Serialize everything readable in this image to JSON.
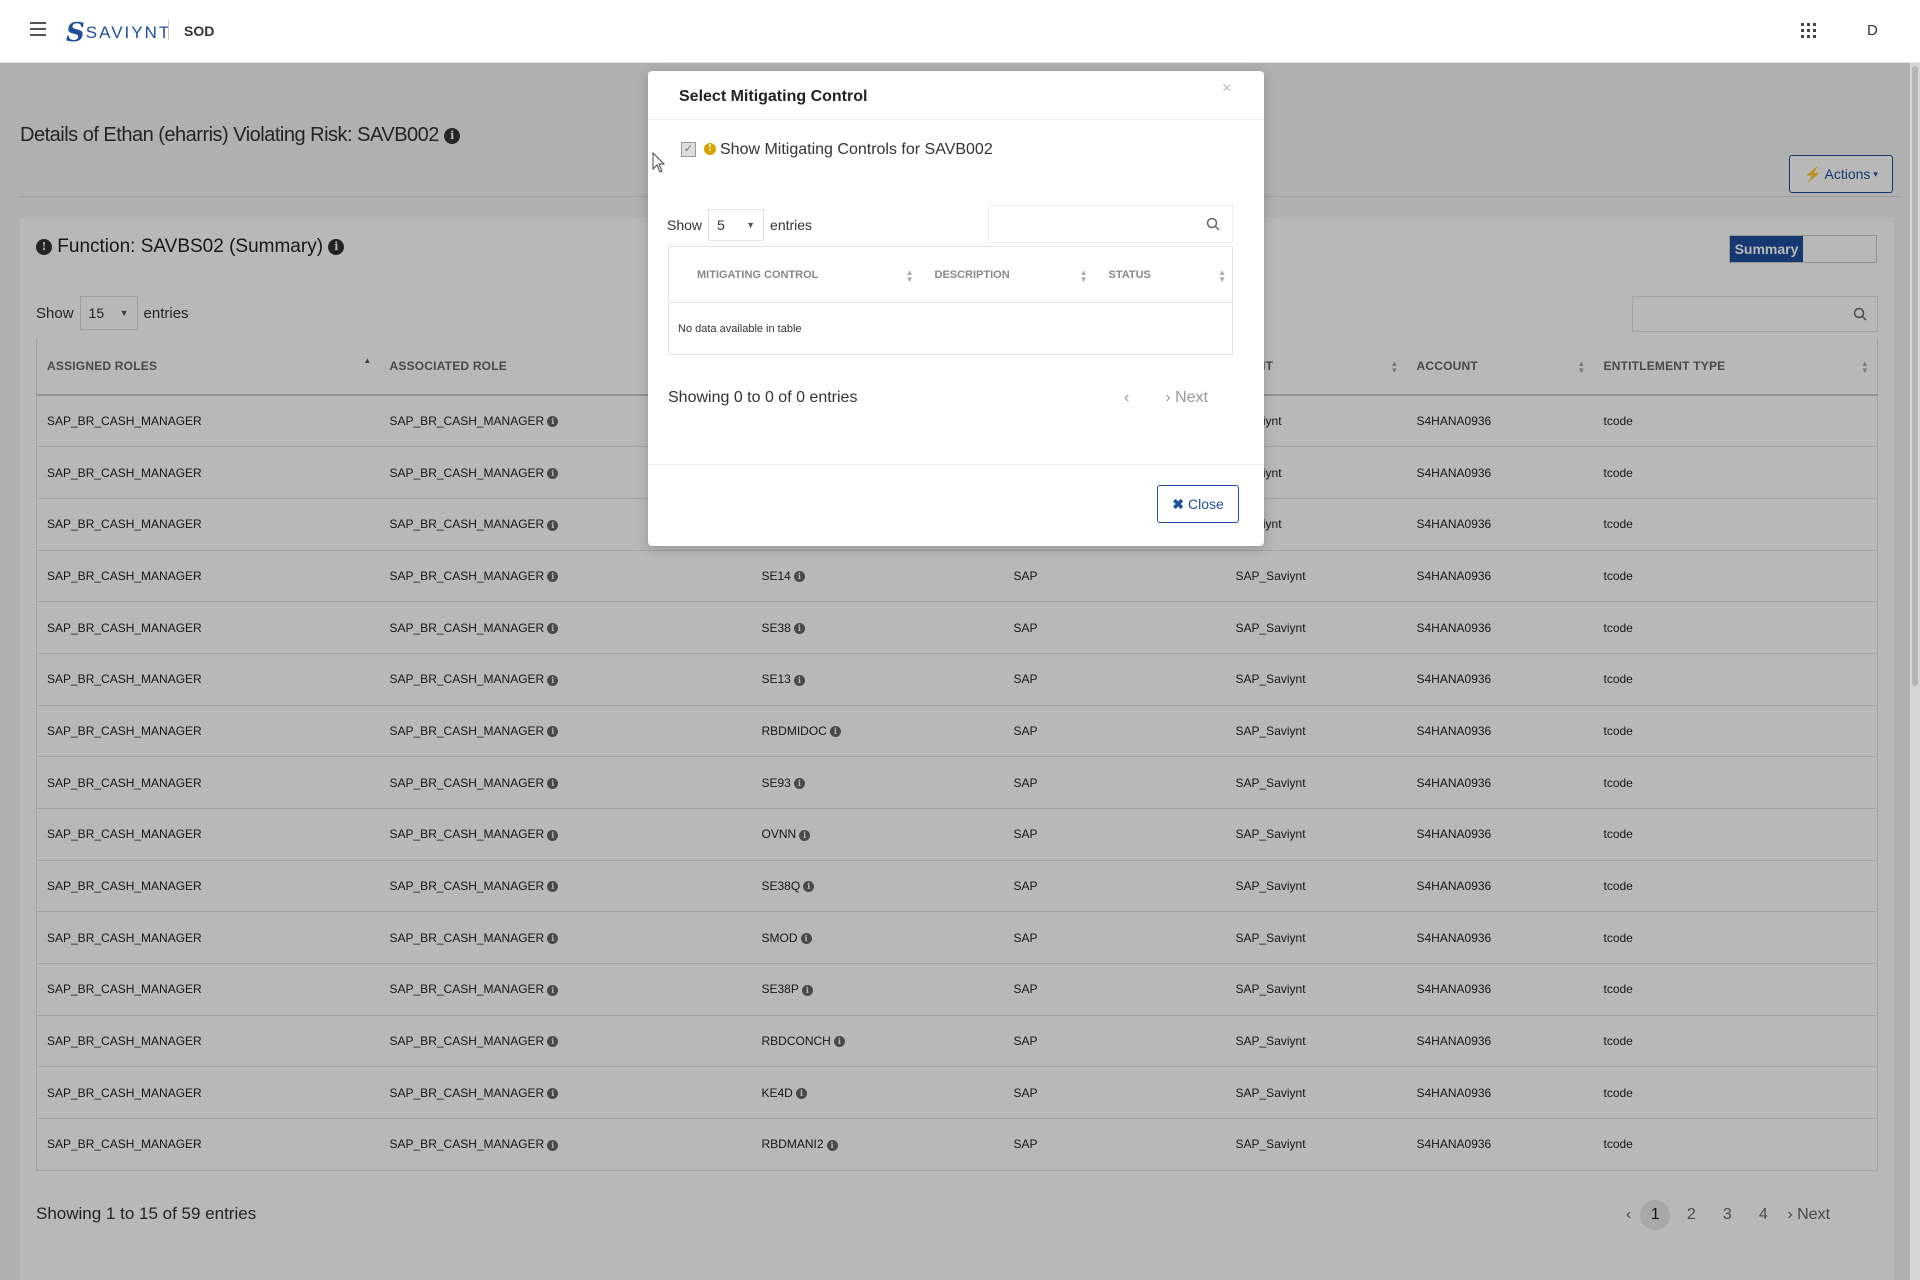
{
  "header": {
    "logo_text": "SAVIYNT",
    "app_name": "SOD",
    "avatar_initial": "D"
  },
  "page": {
    "title": "Details of Ethan (eharris) Violating Risk: SAVB002",
    "actions_label": "Actions",
    "function_title": "Function: SAVBS02 (Summary)",
    "toggle_label": "Summary"
  },
  "table": {
    "show_label": "Show",
    "entries_label": "entries",
    "page_size": "15",
    "columns": [
      "ASSIGNED ROLES",
      "ASSOCIATED ROLE",
      "",
      "",
      "POINT",
      "ACCOUNT",
      "ENTITLEMENT TYPE"
    ],
    "rows": [
      [
        "SAP_BR_CASH_MANAGER",
        "SAP_BR_CASH_MANAGER",
        "",
        "",
        "_Saviynt",
        "S4HANA0936",
        "tcode"
      ],
      [
        "SAP_BR_CASH_MANAGER",
        "SAP_BR_CASH_MANAGER",
        "",
        "",
        "_Saviynt",
        "S4HANA0936",
        "tcode"
      ],
      [
        "SAP_BR_CASH_MANAGER",
        "SAP_BR_CASH_MANAGER",
        "",
        "",
        "_Saviynt",
        "S4HANA0936",
        "tcode"
      ],
      [
        "SAP_BR_CASH_MANAGER",
        "SAP_BR_CASH_MANAGER",
        "SE14",
        "SAP",
        "SAP_Saviynt",
        "S4HANA0936",
        "tcode"
      ],
      [
        "SAP_BR_CASH_MANAGER",
        "SAP_BR_CASH_MANAGER",
        "SE38",
        "SAP",
        "SAP_Saviynt",
        "S4HANA0936",
        "tcode"
      ],
      [
        "SAP_BR_CASH_MANAGER",
        "SAP_BR_CASH_MANAGER",
        "SE13",
        "SAP",
        "SAP_Saviynt",
        "S4HANA0936",
        "tcode"
      ],
      [
        "SAP_BR_CASH_MANAGER",
        "SAP_BR_CASH_MANAGER",
        "RBDMIDOC",
        "SAP",
        "SAP_Saviynt",
        "S4HANA0936",
        "tcode"
      ],
      [
        "SAP_BR_CASH_MANAGER",
        "SAP_BR_CASH_MANAGER",
        "SE93",
        "SAP",
        "SAP_Saviynt",
        "S4HANA0936",
        "tcode"
      ],
      [
        "SAP_BR_CASH_MANAGER",
        "SAP_BR_CASH_MANAGER",
        "OVNN",
        "SAP",
        "SAP_Saviynt",
        "S4HANA0936",
        "tcode"
      ],
      [
        "SAP_BR_CASH_MANAGER",
        "SAP_BR_CASH_MANAGER",
        "SE38Q",
        "SAP",
        "SAP_Saviynt",
        "S4HANA0936",
        "tcode"
      ],
      [
        "SAP_BR_CASH_MANAGER",
        "SAP_BR_CASH_MANAGER",
        "SMOD",
        "SAP",
        "SAP_Saviynt",
        "S4HANA0936",
        "tcode"
      ],
      [
        "SAP_BR_CASH_MANAGER",
        "SAP_BR_CASH_MANAGER",
        "SE38P",
        "SAP",
        "SAP_Saviynt",
        "S4HANA0936",
        "tcode"
      ],
      [
        "SAP_BR_CASH_MANAGER",
        "SAP_BR_CASH_MANAGER",
        "RBDCONCH",
        "SAP",
        "SAP_Saviynt",
        "S4HANA0936",
        "tcode"
      ],
      [
        "SAP_BR_CASH_MANAGER",
        "SAP_BR_CASH_MANAGER",
        "KE4D",
        "SAP",
        "SAP_Saviynt",
        "S4HANA0936",
        "tcode"
      ],
      [
        "SAP_BR_CASH_MANAGER",
        "SAP_BR_CASH_MANAGER",
        "RBDMANI2",
        "SAP",
        "SAP_Saviynt",
        "S4HANA0936",
        "tcode"
      ]
    ],
    "footer_info": "Showing 1 to 15 of 59 entries",
    "pages": [
      "1",
      "2",
      "3",
      "4"
    ],
    "next_label": "Next",
    "active_page": "1"
  },
  "modal": {
    "title": "Select Mitigating Control",
    "close_x": "×",
    "checkbox_label": "Show Mitigating Controls for SAVB002",
    "show_label": "Show",
    "entries_label": "entries",
    "page_size": "5",
    "columns": [
      "MITIGATING CONTROL",
      "DESCRIPTION",
      "STATUS"
    ],
    "empty_text": "No data available in table",
    "info_text": "Showing 0 to 0 of 0 entries",
    "prev_label": "‹",
    "next_label": "› Next",
    "close_label": "Close"
  },
  "colors": {
    "brand": "#1f4e9c",
    "warning": "#d4a400"
  }
}
